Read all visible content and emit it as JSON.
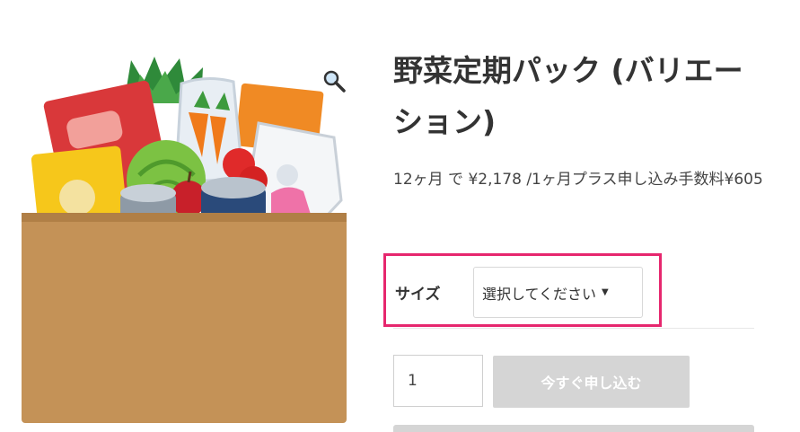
{
  "product": {
    "title": "野菜定期パック (バリエーション)",
    "price_text": "12ヶ月 で ¥2,178 /1ヶ月プラス申し込み手数料¥605"
  },
  "variation": {
    "label": "サイズ",
    "select_value": "選択してください"
  },
  "purchase": {
    "quantity": "1",
    "button_label": "今すぐ申し込む"
  },
  "colors": {
    "highlight_border": "#e6276e",
    "disabled_button": "#d5d5d5"
  },
  "icons": {
    "zoom": "magnifier-icon",
    "select_caret": "caret-down-icon"
  }
}
